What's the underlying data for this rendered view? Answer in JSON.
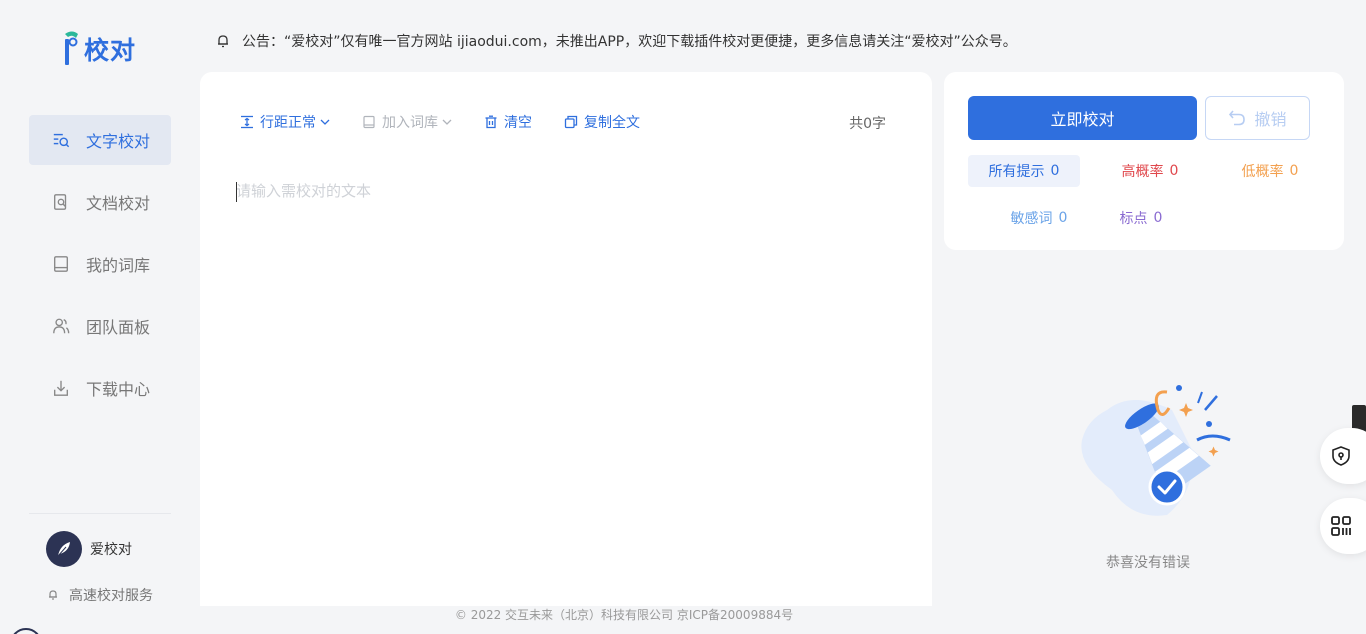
{
  "logo": {
    "text": "校对"
  },
  "nav": [
    {
      "label": "文字校对",
      "icon": "text-check-icon",
      "active": true
    },
    {
      "label": "文档校对",
      "icon": "document-check-icon",
      "active": false
    },
    {
      "label": "我的词库",
      "icon": "book-icon",
      "active": false
    },
    {
      "label": "团队面板",
      "icon": "team-icon",
      "active": false
    },
    {
      "label": "下载中心",
      "icon": "download-icon",
      "active": false
    }
  ],
  "user": {
    "name": "爱校对",
    "service": "高速校对服务"
  },
  "notice": {
    "text": "公告：“爱校对”仅有唯一官方网站 ijiaodui.com，未推出APP，欢迎下载插件校对更便捷，更多信息请关注“爱校对”公众号。"
  },
  "toolbar": {
    "line_spacing": "行距正常",
    "add_dict": "加入词库",
    "clear": "清空",
    "copy_all": "复制全文",
    "word_count": "共0字"
  },
  "editor": {
    "placeholder": "请输入需校对的文本"
  },
  "panel": {
    "check_button": "立即校对",
    "undo_button": "撤销",
    "filters": [
      {
        "label": "所有提示",
        "count": "0",
        "color": "#2f6fde"
      },
      {
        "label": "高概率",
        "count": "0",
        "color": "#e0474c"
      },
      {
        "label": "低概率",
        "count": "0",
        "color": "#f3a04f"
      },
      {
        "label": "敏感词",
        "count": "0",
        "color": "#6aa3e8"
      },
      {
        "label": "标点",
        "count": "0",
        "color": "#8a6bd1"
      }
    ]
  },
  "empty_state": {
    "text": "恭喜没有错误"
  },
  "footer": {
    "text": "© 2022 交互未来（北京）科技有限公司 京ICP备20009884号"
  },
  "colors": {
    "accent": "#2f6fde",
    "background": "#f4f5f7"
  }
}
